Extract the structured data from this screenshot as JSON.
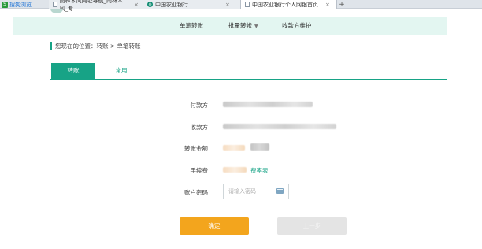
{
  "browser": {
    "brand_label": "搜狗浏览",
    "tabs": [
      {
        "title": "雨林木风网址导航_雨林木风_专",
        "active": false
      },
      {
        "title": "中国农业银行",
        "active": false
      },
      {
        "title": "中国农业银行个人网银首页",
        "active": true
      }
    ],
    "new_tab_label": "+",
    "close_glyph": "×"
  },
  "nav": {
    "items": [
      {
        "label": "单笔转账",
        "has_dropdown": false
      },
      {
        "label": "批量转帐",
        "has_dropdown": true
      },
      {
        "label": "收款方维护",
        "has_dropdown": false
      }
    ]
  },
  "breadcrumb": {
    "text": "您现在的位置：转账 > 单笔转账"
  },
  "page_tabs": [
    {
      "label": "转账",
      "active": true
    },
    {
      "label": "常用",
      "active": false
    }
  ],
  "form": {
    "payer_label": "付款方",
    "payee_label": "收款方",
    "amount_label": "转账金额",
    "fee_label": "手续费",
    "fee_link": "费率表",
    "password_label": "账户密码",
    "password_placeholder": "请输入密码"
  },
  "buttons": {
    "confirm": "确定",
    "previous": "上一步"
  },
  "colors": {
    "accent": "#17a386",
    "nav_background": "#e3f6f1",
    "confirm_button": "#f3a51d",
    "disabled_button": "#e4e4e4"
  }
}
